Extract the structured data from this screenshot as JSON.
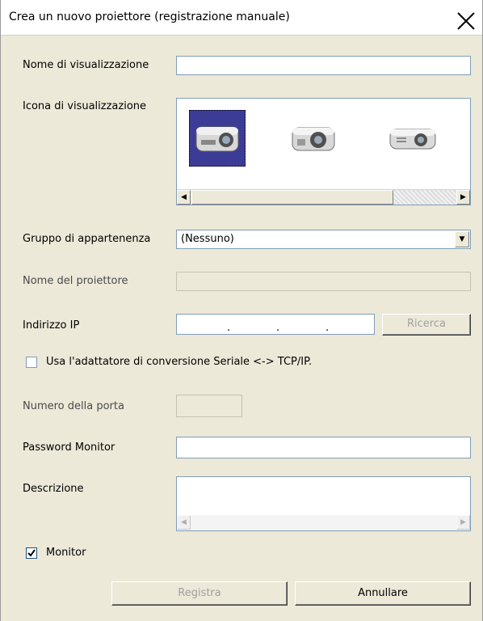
{
  "window": {
    "title": "Crea un nuovo proiettore (registrazione manuale)",
    "close_label": "X"
  },
  "form": {
    "display_name": {
      "label": "Nome di visualizzazione",
      "value": ""
    },
    "display_icon": {
      "label": "Icona di visualizzazione",
      "icons": [
        "projector-icon-1",
        "projector-icon-2",
        "projector-icon-3"
      ],
      "selected_index": 0
    },
    "group": {
      "label": "Gruppo di appartenenza",
      "value": "(Nessuno)"
    },
    "projector_name": {
      "label": "Nome del proiettore",
      "value": ""
    },
    "ip": {
      "label": "Indirizzo IP",
      "dots": [
        ".",
        ".",
        "."
      ],
      "search_label": "Ricerca"
    },
    "adapter": {
      "label": "Usa l'adattatore di conversione Seriale <-> TCP/IP.",
      "checked": false
    },
    "port": {
      "label": "Numero della porta",
      "value": ""
    },
    "password": {
      "label": "Password Monitor",
      "value": ""
    },
    "description": {
      "label": "Descrizione",
      "value": ""
    },
    "monitor": {
      "label": "Monitor",
      "checked": true
    }
  },
  "buttons": {
    "register": "Registra",
    "cancel": "Annullare"
  },
  "colors": {
    "dialog_bg": "#ece9d8",
    "selected_icon_bg": "#3c3c96",
    "input_border": "#7f9db9"
  }
}
